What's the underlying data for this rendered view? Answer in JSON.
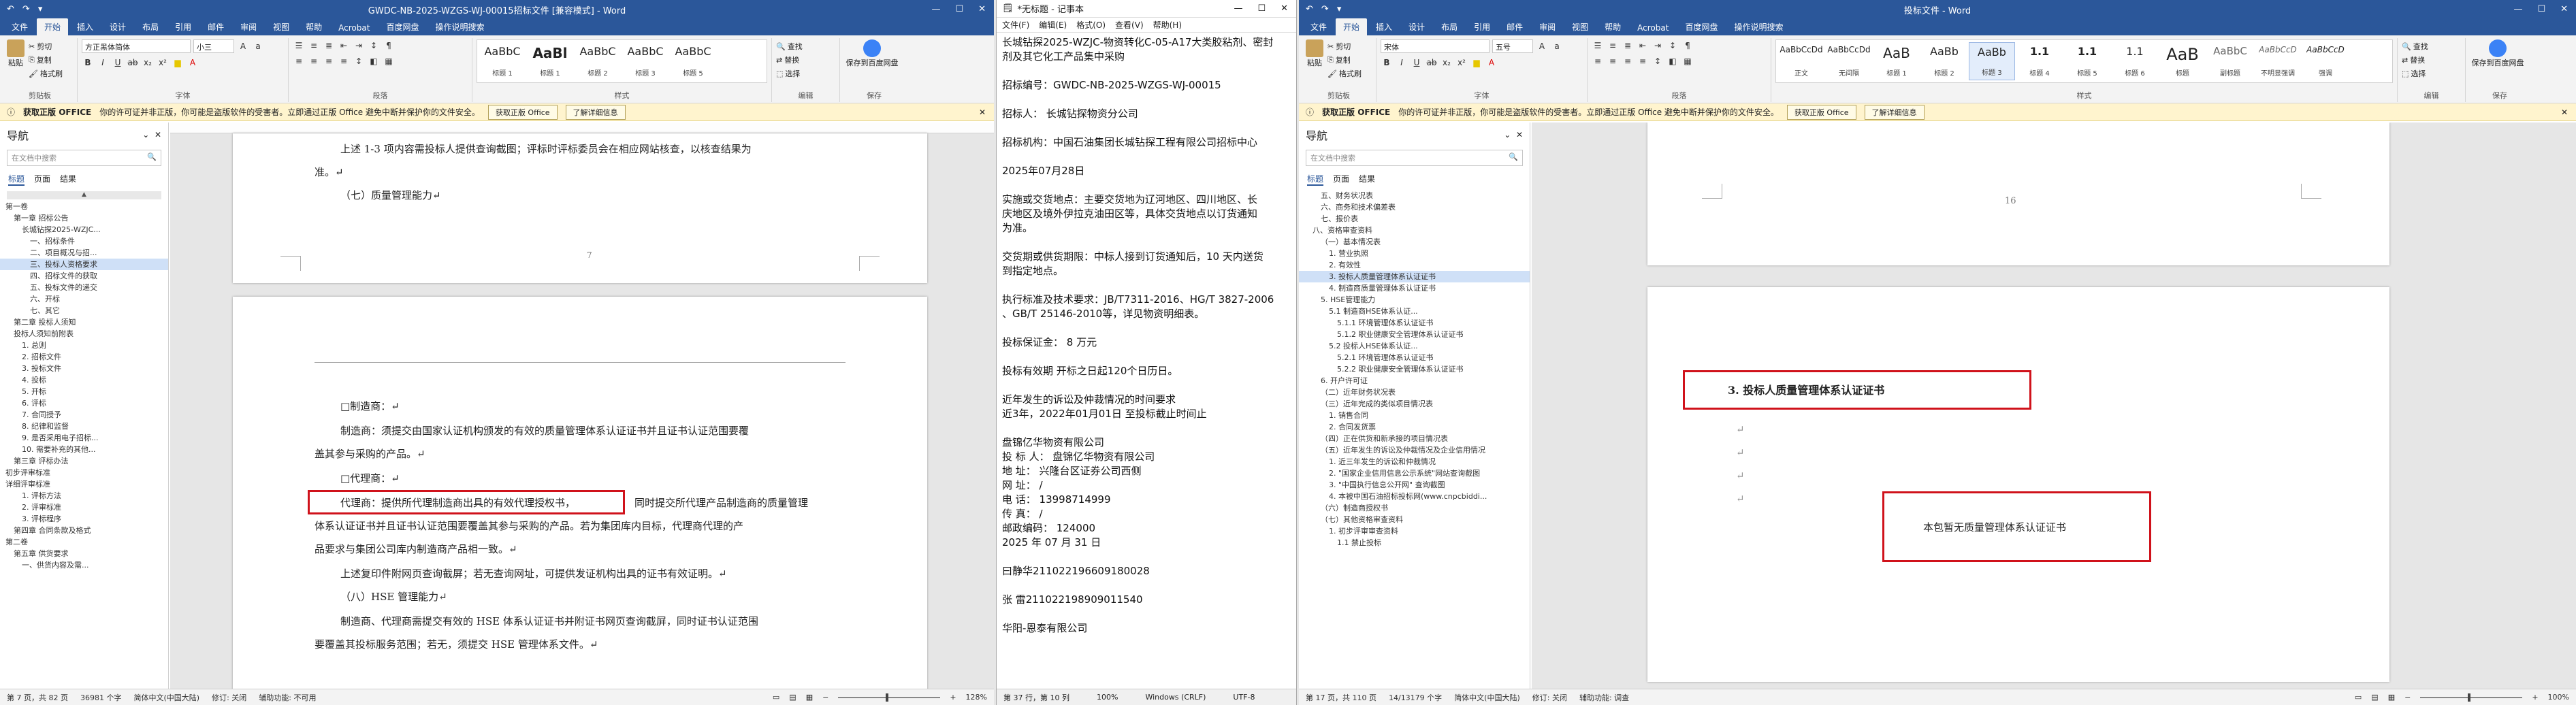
{
  "left": {
    "title": "GWDC-NB-2025-WZGS-WJ-00015招标文件 [兼容模式] - Word",
    "qa": [
      "↶",
      "↷",
      "▾"
    ],
    "tabs": [
      "文件",
      "开始",
      "插入",
      "设计",
      "布局",
      "引用",
      "邮件",
      "审阅",
      "视图",
      "帮助",
      "Acrobat",
      "百度网盘",
      "操作说明搜索"
    ],
    "clipboard": {
      "paste": "粘贴",
      "cut": "剪切",
      "copy": "复制",
      "fmt": "格式刷",
      "label": "剪贴板"
    },
    "font": {
      "name": "方正黑体简体",
      "size": "小三",
      "label": "字体"
    },
    "para_label": "段落",
    "styles": [
      {
        "p": "AaBbC",
        "n": "标题 1"
      },
      {
        "p": "AaBl",
        "n": "标题 1"
      },
      {
        "p": "AaBbC",
        "n": "标题 2"
      },
      {
        "p": "AaBbC",
        "n": "标题 3"
      },
      {
        "p": "AaBbC",
        "n": "标题 5"
      }
    ],
    "styles_label": "样式",
    "edit": {
      "find": "查找",
      "replace": "替换",
      "select": "选择",
      "label": "编辑"
    },
    "save": {
      "btn": "保存到百度网盘",
      "label": "保存"
    },
    "msg": {
      "title": "获取正版 OFFICE",
      "text": "你的许可证并非正版，你可能是盗版软件的受害者。立即通过正版 Office 避免中断并保护你的文件安全。",
      "b1": "获取正版 Office",
      "b2": "了解详细信息"
    },
    "nav": {
      "title": "导航",
      "search": "在文档中搜索",
      "tabs": [
        "标题",
        "页面",
        "结果"
      ],
      "items": [
        {
          "t": "第一卷",
          "l": 0
        },
        {
          "t": "第一章 招标公告",
          "l": 1
        },
        {
          "t": "长城钻探2025-WZJC...",
          "l": 2
        },
        {
          "t": "一、招标条件",
          "l": 3
        },
        {
          "t": "二、项目概况与招...",
          "l": 3
        },
        {
          "t": "三、投标人资格要求",
          "l": 3,
          "sel": true
        },
        {
          "t": "四、招标文件的获取",
          "l": 3
        },
        {
          "t": "五、投标文件的递交",
          "l": 3
        },
        {
          "t": "六、开标",
          "l": 3
        },
        {
          "t": "七、其它",
          "l": 3
        },
        {
          "t": "第二章 投标人须知",
          "l": 1
        },
        {
          "t": "投标人须知前附表",
          "l": 1
        },
        {
          "t": "1. 总则",
          "l": 2
        },
        {
          "t": "2. 招标文件",
          "l": 2
        },
        {
          "t": "3. 投标文件",
          "l": 2
        },
        {
          "t": "4. 投标",
          "l": 2
        },
        {
          "t": "5. 开标",
          "l": 2
        },
        {
          "t": "6. 评标",
          "l": 2
        },
        {
          "t": "7. 合同授予",
          "l": 2
        },
        {
          "t": "8. 纪律和监督",
          "l": 2
        },
        {
          "t": "9. 是否采用电子招标...",
          "l": 2
        },
        {
          "t": "10. 需要补充的其他...",
          "l": 2
        },
        {
          "t": "第三章 评标办法",
          "l": 1
        },
        {
          "t": "初步评审标准",
          "l": 0
        },
        {
          "t": "详细评审标准",
          "l": 0
        },
        {
          "t": "1. 评标方法",
          "l": 2
        },
        {
          "t": "2. 评审标准",
          "l": 2
        },
        {
          "t": "3. 评标程序",
          "l": 2
        },
        {
          "t": "第四章 合同条款及格式",
          "l": 1
        },
        {
          "t": "第二卷",
          "l": 0
        },
        {
          "t": "第五章 供货要求",
          "l": 1
        },
        {
          "t": "一、供货内容及需...",
          "l": 2
        }
      ]
    },
    "p1": [
      "上述 1-3 项内容需投标人提供查询截图；评标时评标委员会在相应网站核查，以核查结果为",
      "准。↵",
      "（七）质量管理能力↵"
    ],
    "pageno": "7",
    "p2": [
      "□制造商：↵",
      "制造商：须提交由国家认证机构颁发的有效的质量管理体系认证证书并且证书认证范围要覆",
      "盖其参与采购的产品。↵",
      "□代理商：↵",
      "代理商：提供所代理制造商出具的有效代理授权书，",
      "同时提交所代理产品制造商的质量管理",
      "体系认证证书并且证书认证范围要覆盖其参与采购的产品。若为集团库内目标，代理商代理的产",
      "品要求与集团公司库内制造商产品相一致。↵",
      "上述复印件附网页查询截屏；若无查询网址，可提供发证机构出具的证书有效证明。↵",
      "（八）HSE 管理能力↵",
      "制造商、代理商需提交有效的 HSE 体系认证证书并附证书网页查询截屏，同时证书认证范围",
      "要覆盖其投标服务范围；若无，须提交 HSE 管理体系文件。↵"
    ],
    "status": {
      "page": "第 7 页，共 82 页",
      "words": "36981 个字",
      "lang": "简体中文(中国大陆)",
      "rev": "修订: 关闭",
      "acc": "辅助功能: 不可用",
      "zoom": "128%"
    }
  },
  "mid": {
    "title": "*无标题 - 记事本",
    "menu": [
      "文件(F)",
      "编辑(E)",
      "格式(O)",
      "查看(V)",
      "帮助(H)"
    ],
    "lines": [
      "长城钻探2025-WZJC-物资转化C-05-A17大类胶粘剂、密封",
      "剂及其它化工产品集中采购",
      "",
      "招标编号：GWDC-NB-2025-WZGS-WJ-00015",
      "",
      "招标人：  长城钻探物资分公司",
      "",
      "招标机构：中国石油集团长城钻探工程有限公司招标中心",
      "",
      "2025年07月28日",
      "",
      "实施或交货地点：主要交货地为辽河地区、四川地区、长",
      "庆地区及境外伊拉克油田区等，具体交货地点以订货通知",
      "为准。",
      "",
      "交货期或供货期限：中标人接到订货通知后，10 天内送货",
      "到指定地点。",
      "",
      "执行标准及技术要求：JB/T7311-2016、HG/T 3827-2006",
      "、GB/T 25146-2010等，详见物资明细表。",
      "",
      "投标保证金：  8  万元",
      "",
      "投标有效期  开标之日起120个日历日。",
      "",
      "近年发生的诉讼及仲裁情况的时间要求",
      "近3年，2022年01月01日 至投标截止时间止",
      "",
      "盘锦亿华物资有限公司",
      "投 标 人：  盘锦亿华物资有限公司",
      "地    址：  兴隆台区证券公司西侧",
      "网    址：  /",
      "电    话：  13998714999",
      "传    真：  /",
      "邮政编码：  124000",
      "2025 年 07 月 31 日",
      "",
      "曰静华211022196609180028",
      "",
      "张    雷211022198909011540",
      "",
      "华阳-恩泰有限公司"
    ],
    "status": [
      "第 37 行，第 10 列",
      "100%",
      "Windows (CRLF)",
      "UTF-8"
    ]
  },
  "right": {
    "title": "投标文件 - Word",
    "qa": [
      "↶",
      "↷",
      "▾"
    ],
    "tabs": [
      "文件",
      "开始",
      "插入",
      "设计",
      "布局",
      "引用",
      "邮件",
      "审阅",
      "视图",
      "帮助",
      "Acrobat",
      "百度网盘",
      "操作说明搜索"
    ],
    "clipboard": {
      "paste": "粘贴",
      "cut": "剪切",
      "copy": "复制",
      "fmt": "格式刷",
      "label": "剪贴板"
    },
    "font": {
      "name": "宋体",
      "size": "五号",
      "label": "字体"
    },
    "para_label": "段落",
    "styles": [
      {
        "p": "AaBbCcDd",
        "n": "正文"
      },
      {
        "p": "AaBbCcDd",
        "n": "无间隔"
      },
      {
        "p": "AaB",
        "n": "标题 1"
      },
      {
        "p": "AaBb",
        "n": "标题 2"
      },
      {
        "p": "AaBb",
        "n": "标题 3"
      },
      {
        "p": "1.1",
        "n": "标题 4"
      },
      {
        "p": "1.1",
        "n": "标题 5"
      },
      {
        "p": "1.1",
        "n": "标题 6"
      },
      {
        "p": "AaB",
        "n": "标题"
      },
      {
        "p": "AaBbC",
        "n": "副标题"
      },
      {
        "p": "AaBbCcD",
        "n": "不明显强调"
      },
      {
        "p": "AaBbCcD",
        "n": "强调"
      }
    ],
    "styles_label": "样式",
    "edit": {
      "find": "查找",
      "replace": "替换",
      "select": "选择",
      "label": "编辑"
    },
    "save": {
      "btn": "保存到百度网盘",
      "label": "保存"
    },
    "msg": {
      "title": "获取正版 OFFICE",
      "text": "你的许可证并非正版，你可能是盗版软件的受害者。立即通过正版 Office 避免中断并保护你的文件安全。",
      "b1": "获取正版 Office",
      "b2": "了解详细信息"
    },
    "nav": {
      "title": "导航",
      "search": "在文档中搜索",
      "tabs": [
        "标题",
        "页面",
        "结果"
      ],
      "items": [
        {
          "t": "五、财务状况表",
          "l": 2
        },
        {
          "t": "六、商务和技术偏差表",
          "l": 2
        },
        {
          "t": "七、报价表",
          "l": 2
        },
        {
          "t": "八、资格审查资料",
          "l": 1
        },
        {
          "t": "（一）基本情况表",
          "l": 2
        },
        {
          "t": "1. 营业执照",
          "l": 3
        },
        {
          "t": "2. 有效性",
          "l": 3
        },
        {
          "t": "3. 投标人质量管理体系认证证书",
          "l": 3,
          "sel": true
        },
        {
          "t": "4. 制造商质量管理体系认证证书",
          "l": 3
        },
        {
          "t": "5. HSE管理能力",
          "l": 2
        },
        {
          "t": "5.1 制造商HSE体系认证...",
          "l": 3
        },
        {
          "t": "5.1.1 环境管理体系认证证书",
          "l": 4
        },
        {
          "t": "5.1.2 职业健康安全管理体系认证证书",
          "l": 4
        },
        {
          "t": "5.2 投标人HSE体系认证...",
          "l": 3
        },
        {
          "t": "5.2.1 环境管理体系认证证书",
          "l": 4
        },
        {
          "t": "5.2.2 职业健康安全管理体系认证证书",
          "l": 4
        },
        {
          "t": "6. 开户许可证",
          "l": 2
        },
        {
          "t": "（二）近年财务状况表",
          "l": 2
        },
        {
          "t": "（三）近年完成的类似项目情况表",
          "l": 2
        },
        {
          "t": "1. 销售合同",
          "l": 3
        },
        {
          "t": "2. 合同发货票",
          "l": 3
        },
        {
          "t": "（四）正在供货和新承接的项目情况表",
          "l": 2
        },
        {
          "t": "（五）近年发生的诉讼及仲裁情况及企业信用情况",
          "l": 2
        },
        {
          "t": "1. 近三年发生的诉讼和仲裁情况",
          "l": 3
        },
        {
          "t": "2. \"国家企业信用信息公示系统\"网站查询截图",
          "l": 3
        },
        {
          "t": "3. \"中国执行信息公开网\" 查询截图",
          "l": 3
        },
        {
          "t": "4. 本被中国石油招标投标网(www.cnpcbiddi...",
          "l": 3
        },
        {
          "t": "（六）制造商授权书",
          "l": 2
        },
        {
          "t": "（七）其他资格审查资料",
          "l": 2
        },
        {
          "t": "1. 初步评审审查资料",
          "l": 3
        },
        {
          "t": "1.1 禁止投标",
          "l": 4
        }
      ]
    },
    "pageno": "16",
    "heading": "3.    投标人质量管理体系认证证书",
    "note": "本包暂无质量管理体系认证证书",
    "status": {
      "page": "第 17 页，共 110 页",
      "words": "14/13179 个字",
      "lang": "简体中文(中国大陆)",
      "rev": "修订: 关闭",
      "acc": "辅助功能: 调查",
      "zoom": "100%"
    }
  }
}
